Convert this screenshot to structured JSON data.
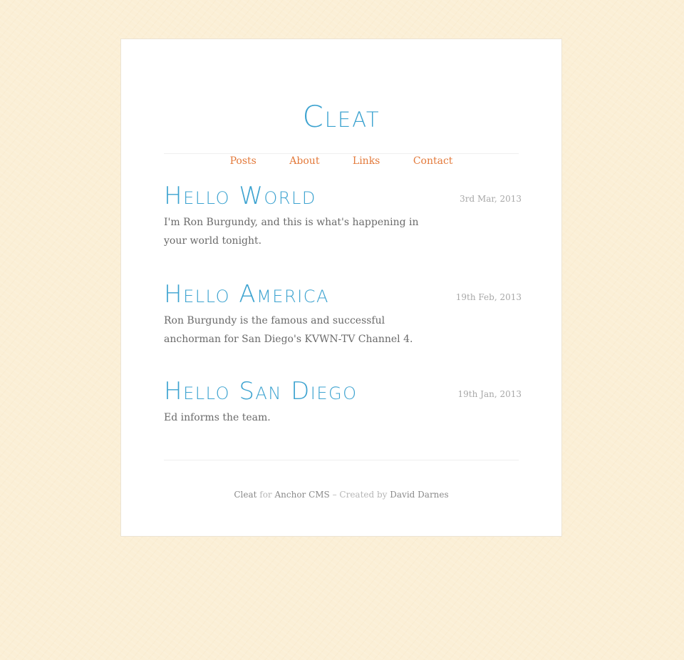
{
  "site": {
    "title": "Cleat"
  },
  "nav": {
    "items": [
      {
        "label": "Posts"
      },
      {
        "label": "About"
      },
      {
        "label": "Links"
      },
      {
        "label": "Contact"
      }
    ]
  },
  "posts": [
    {
      "title": "Hello World",
      "date": "3rd Mar, 2013",
      "excerpt": "I'm Ron Burgundy, and this is what's happening in your world tonight."
    },
    {
      "title": "Hello America",
      "date": "19th Feb, 2013",
      "excerpt": "Ron Burgundy is the famous and successful anchorman for San Diego's KVWN-TV Channel 4."
    },
    {
      "title": "Hello San Diego",
      "date": "19th Jan, 2013",
      "excerpt": "Ed informs the team."
    }
  ],
  "footer": {
    "theme_link": "Cleat",
    "for_text": " for ",
    "cms_link": "Anchor CMS",
    "created_text": " – Created by ",
    "author_link": "David Darnes"
  },
  "colors": {
    "accent_blue": "#3da3d0",
    "link_orange": "#e3793a",
    "background": "#fbefd6"
  }
}
